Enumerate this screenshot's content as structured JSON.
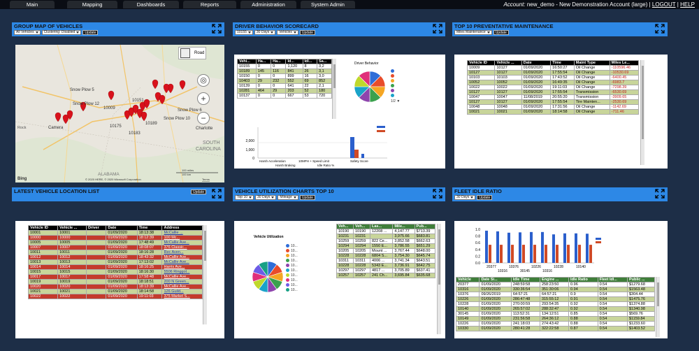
{
  "nav": {
    "tabs": [
      "Main",
      "Mapping",
      "Dashboards",
      "Reports",
      "Administration",
      "System Admin"
    ],
    "account_label": "Account:",
    "account_value": "new_demo - New Demonstration Account (large)",
    "logout": "LOGOUT",
    "help": "HELP",
    "sep": "|"
  },
  "widgets": {
    "map": {
      "title": "GROUP MAP OF VEHICLES",
      "sel1": "All Vehicles",
      "sel2": "Clustering: Disabled",
      "update": "Update",
      "road": "Road",
      "labels": [
        "Snow Plow 5",
        "Snow Plow 12",
        "Snow Plow 6",
        "Snow Plow 10",
        "10009",
        "10151",
        "10175",
        "10183",
        "10189",
        "Camera",
        "Charlotte",
        "SOUTH",
        "CAROLINA",
        "ALABAMA",
        "Rock"
      ],
      "bing": "Bing",
      "copyright": "© 2020 HERE, © 2020 Microsoft Corporation",
      "terms": "Terms",
      "scale": "100 miles",
      "scale_km": "100 km"
    },
    "scorecard": {
      "title": "DRIVER BEHAVIOR SCORECARD",
      "sel1": "10155",
      "sel2": "30 Days",
      "sel3": "Vehicles",
      "update": "Update",
      "headers": [
        "Vehi...",
        "Ha...",
        "Ha...",
        "Id...",
        "Idl...",
        "Sa..."
      ],
      "rows": [
        [
          "10155",
          "0",
          "0",
          "1,120",
          "8",
          "3,2"
        ],
        [
          "10189",
          "145",
          "116",
          "841",
          "26",
          "3,1"
        ],
        [
          "10150",
          "0",
          "0",
          "899",
          "16",
          "3,0"
        ],
        [
          "10403",
          "29",
          "232",
          "552",
          "69",
          "852"
        ],
        [
          "10139",
          "0",
          "0",
          "641",
          "22",
          "2,1"
        ],
        [
          "10281",
          "464",
          "29",
          "203",
          "52",
          "180"
        ],
        [
          "10137",
          "0",
          "0",
          "667",
          "53",
          "720"
        ]
      ],
      "pie_title": "Driver Behavior",
      "pie_nav": "1/2",
      "bar_axis": [
        "2,000",
        "1,000",
        "0"
      ],
      "bar_cats": [
        "Harsh Acceleration",
        "10MPH + Speed Limit",
        "Safety Score"
      ],
      "bar_cats2": [
        "Harsh Braking",
        "Idle Ratio %"
      ]
    },
    "maintenance": {
      "title": "TOP 10 PREVENTATIVE MAINTENANCE",
      "sel1": "Miles Maintenance",
      "update": "Update",
      "headers": [
        "Vehicle ID",
        "Vehicle ...",
        "Date",
        "Time",
        "Maint Type",
        "Miles Le..."
      ],
      "rows": [
        [
          "10009",
          "10127",
          "01/09/2020",
          "16:50:27",
          "Oil Change",
          "-110596.46"
        ],
        [
          "10127",
          "10127",
          "01/09/2020",
          "17:55:54",
          "Oil Change",
          "-10530.69"
        ],
        [
          "10103",
          "10103",
          "01/09/2020",
          "17:43:52",
          "Oil Change",
          "-6400.45"
        ],
        [
          "10052",
          "10052",
          "01/09/2020",
          "16:49:35",
          "Oil Change",
          "-6983.7"
        ],
        [
          "10022",
          "10022",
          "01/09/2020",
          "19:11:03",
          "Oil Change",
          "-7298.39"
        ],
        [
          "10127",
          "10127",
          "01/09/2020",
          "17:55:54",
          "Transmission",
          "-6530.69"
        ],
        [
          "10047",
          "10047",
          "11/08/2019",
          "20:55:20",
          "Transmission",
          "-3909.65"
        ],
        [
          "10127",
          "10127",
          "01/09/2020",
          "17:55:54",
          "Tire Mainten...",
          "-2530.69"
        ],
        [
          "10048",
          "10048",
          "01/09/2020",
          "17:31:56",
          "Oil Change",
          "-1142.69"
        ],
        [
          "10021",
          "10021",
          "01/09/2020",
          "18:14:58",
          "Oil Change",
          "-711.46"
        ]
      ]
    },
    "location": {
      "title": "LATEST VEHICLE LOCATION LIST",
      "update": "Update",
      "headers": [
        "Vehicle ID",
        "Vehicle ...",
        "Driver",
        "Date",
        "Time",
        "Address"
      ],
      "rows": [
        [
          "10001",
          "10001",
          "",
          "01/09/2020",
          "18:13:38",
          "McCallie ..."
        ],
        [
          "10000",
          "10000",
          "",
          "01/09/2020",
          "18:12:39",
          "100 Mc..."
        ],
        [
          "10005",
          "10005",
          "",
          "01/09/2020",
          "17:48:49",
          "McCallie Ave..."
        ],
        [
          "10007",
          "10007",
          "",
          "01/09/2020",
          "18:08:07",
          "376 Classic..."
        ],
        [
          "10011",
          "10011",
          "",
          "01/09/2020",
          "18:16:28",
          "Rec Aven..."
        ],
        [
          "10012",
          "10012",
          "",
          "01/09/2020",
          "18:43:32",
          "McCallie Ave..."
        ],
        [
          "10013",
          "10013",
          "",
          "01/09/2020",
          "17:13:02",
          "McCallie Ave..."
        ],
        [
          "10014",
          "10014",
          "",
          "01/09/2020",
          "18:16:25",
          "Harris Ave..."
        ],
        [
          "10015",
          "10015",
          "",
          "01/09/2020",
          "18:16:30",
          "5506 Ringgol..."
        ],
        [
          "10017",
          "10017",
          "",
          "01/09/2020",
          "17:58:48",
          "McCallie Ave..."
        ],
        [
          "10019",
          "10019",
          "",
          "01/09/2020",
          "18:18:51",
          "200 N Green..."
        ],
        [
          "10020",
          "10020",
          "",
          "01/09/2020",
          "18:13:39",
          "McCallie Ave..."
        ],
        [
          "10021",
          "10021",
          "",
          "01/09/2020",
          "18:14:58",
          "126 Guild..."
        ],
        [
          "10022",
          "10022",
          "",
          "01/09/2020",
          "19:11:03",
          "375 Market S..."
        ]
      ],
      "row_colors": [
        "g",
        "r",
        "g",
        "r",
        "g",
        "r",
        "g",
        "r",
        "g",
        "r",
        "g",
        "r",
        "g",
        "r"
      ]
    },
    "utilization": {
      "title": "VEHICLE UTILIZATION CHARTS TOP 10",
      "sel1": "Top 10",
      "sel2": "30 Days",
      "sel3": "Mileage",
      "update": "Update",
      "pie_title": "Vehicle Utilization",
      "legend": "10...",
      "headers": [
        "Veh...",
        "Veh...",
        "Las...",
        "Mile...",
        "Pub..."
      ],
      "rows": [
        [
          "10190",
          "10190",
          "12208 ...",
          "4,147.77",
          "$713.39"
        ],
        [
          "10231",
          "10231",
          "",
          "3,975.66",
          "$683.81"
        ],
        [
          "10259",
          "10259",
          "822 Ce...",
          "3,852.58",
          "$662.63"
        ],
        [
          "10294",
          "10294",
          "1550 E...",
          "3,786.55",
          "$651.29"
        ],
        [
          "10205",
          "10205",
          "Mount ...",
          "3,767.44",
          "$648.00"
        ],
        [
          "10228",
          "10228",
          "6804 S...",
          "3,754.30",
          "$645.74"
        ],
        [
          "10311",
          "10311",
          "4006 ...",
          "3,741.34",
          "$643.51"
        ],
        [
          "10228",
          "10228",
          "5343 E...",
          "3,736.91",
          "$642.75"
        ],
        [
          "10297",
          "10297",
          "4817 ...",
          "3,705.89",
          "$637.41"
        ],
        [
          "10257",
          "10257",
          "241 Ch...",
          "3,695.84",
          "$635.68"
        ]
      ]
    },
    "idle": {
      "title": "FLEET IDLE RATIO",
      "sel1": "30 Days",
      "update": "Update",
      "axis": [
        "1.0",
        "0.8",
        "0.6",
        "0.4",
        "0.2",
        "0.0"
      ],
      "cats": [
        "20377",
        "10376",
        "10226",
        "10228",
        "10140"
      ],
      "cats2": [
        "10316",
        "30145",
        "10316"
      ],
      "headers": [
        "Vehicle",
        "Date Si...",
        "Idle Time",
        "Engine ...",
        "Idle Ratio",
        "Fleet Idl...",
        "Public ..."
      ],
      "rows": [
        [
          "20377",
          "01/09/2020",
          "248:59:58",
          "258:23:50",
          "0.96",
          "0.54",
          "$1279.68"
        ],
        [
          "10316",
          "01/09/2020",
          "330:36:54",
          "351:30:06",
          "0.94",
          "0.54",
          "$1563.48"
        ],
        [
          "10376",
          "09/26/2019",
          "64:57:21",
          "64:57:21",
          "0.9",
          "0.54",
          "$304.44"
        ],
        [
          "10226",
          "01/09/2020",
          "286:47:48",
          "315:55:12",
          "0.91",
          "0.54",
          "$1475.76"
        ],
        [
          "10228",
          "01/09/2020",
          "270:00:59",
          "293:54:35",
          "0.92",
          "0.54",
          "$1374.88"
        ],
        [
          "10140",
          "01/09/2020",
          "265:57:02",
          "288:32:47",
          "0.92",
          "0.54",
          "$1340.98"
        ],
        [
          "30145",
          "01/09/2020",
          "113:52:31",
          "134:12:51",
          "0.85",
          "0.54",
          "$569.76"
        ],
        [
          "10149",
          "01/09/2020",
          "231:56:58",
          "264:36:12",
          "0.88",
          "0.54",
          "$1159.84"
        ],
        [
          "10226",
          "01/09/2020",
          "241:18:03",
          "274:43:42",
          "0.88",
          "0.54",
          "$1233.60"
        ],
        [
          "10330",
          "01/09/2020",
          "280:41:28",
          "322:22:58",
          "0.87",
          "0.54",
          "$1403.52"
        ]
      ],
      "chart_data": {
        "type": "bar",
        "categories": [
          "20377",
          "10316",
          "10376",
          "10226",
          "10228",
          "10140",
          "30145",
          "10149",
          "10226",
          "10330"
        ],
        "series": [
          {
            "values": [
              0.96,
              0.94,
              0.9,
              0.91,
              0.92,
              0.92,
              0.85,
              0.88,
              0.88,
              0.87
            ]
          },
          {
            "values": [
              0.54,
              0.54,
              0.54,
              0.54,
              0.54,
              0.54,
              0.54,
              0.54,
              0.54,
              0.54
            ]
          }
        ],
        "ylim": [
          0,
          1.0
        ]
      }
    }
  },
  "colors": {
    "nav_bg": "#0a0d14",
    "tab_bg": "#24282e",
    "page_bg": "#1d2e47",
    "widget_bar": "#2d88e6",
    "green_row": "#c8d59a",
    "red_row": "#c43b2c",
    "bar_blue": "#2b5fcc",
    "bar_red": "#d04a26"
  }
}
